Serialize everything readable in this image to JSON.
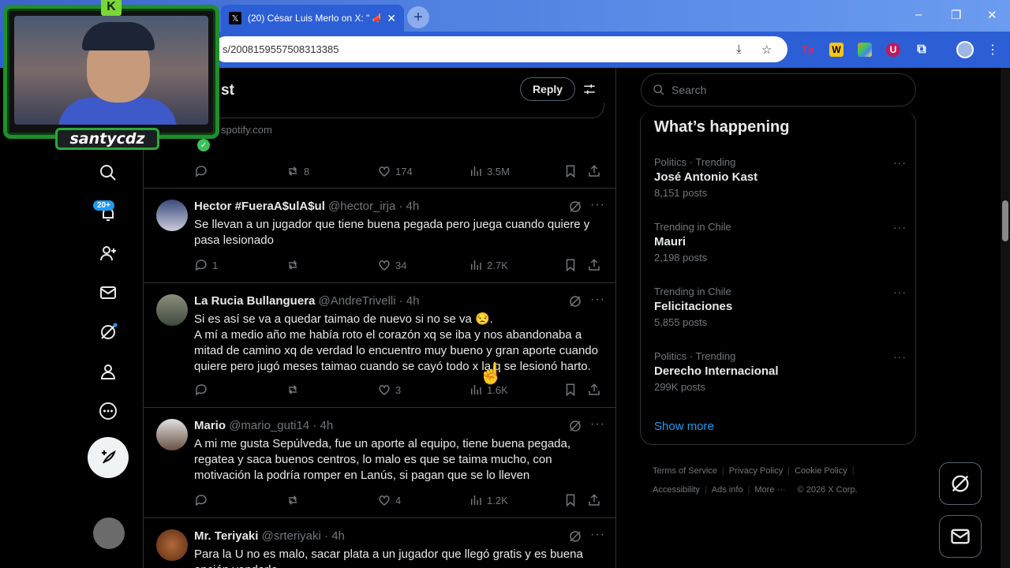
{
  "browser": {
    "tab_title": "(20) César Luis Merlo on X: \" 📣",
    "url": "s/2008159557508313385",
    "extensions": [
      "Tp",
      "W",
      "U"
    ],
    "win_min": "–",
    "win_max": "❐",
    "win_close": "✕"
  },
  "webcam": {
    "channel_name": "santycdz"
  },
  "nav": {
    "notifications_badge": "20+"
  },
  "reply_bar": {
    "partial_title": "st",
    "reply_label": "Reply"
  },
  "prev_tweet": {
    "link_domain": "spotify.com",
    "retweets": "8",
    "likes": "174",
    "views": "3.5M"
  },
  "tweets": [
    {
      "name": "Hector #FueraA$ulA$ul",
      "handle": "@hector_irja",
      "time": "4h",
      "text": "Se llevan a un jugador que tiene buena pegada pero juega cuando quiere y pasa lesionado",
      "replies": "1",
      "retweets": "",
      "likes": "34",
      "views": "2.7K"
    },
    {
      "name": "La Rucia Bullanguera",
      "handle": "@AndreTrivelli",
      "time": "4h",
      "text": "Si es así se va a quedar taimao de nuevo si no se va 😒.\nA mí a medio año me había roto el corazón xq se iba y nos abandonaba a mitad de camino xq de verdad lo encuentro muy bueno y gran aporte cuando quiere pero jugó meses taimao cuando se cayó todo x la q se lesionó harto.",
      "replies": "",
      "retweets": "",
      "likes": "3",
      "views": "1.6K"
    },
    {
      "name": "Mario",
      "handle": "@mario_guti14",
      "time": "4h",
      "text": "A mi me gusta Sepúlveda, fue un aporte al equipo, tiene buena pegada, regatea y saca buenos centros, lo malo es que se taima mucho, con motivación la podría romper en Lanús, si pagan que se lo lleven",
      "replies": "",
      "retweets": "",
      "likes": "4",
      "views": "1.2K"
    },
    {
      "name": "Mr. Teriyaki",
      "handle": "@srteriyaki",
      "time": "4h",
      "text": "Para la U no es malo, sacar plata a un jugador que llegó gratis y es buena opción venderlo.",
      "replies": "",
      "retweets": "",
      "likes": "",
      "views": ""
    }
  ],
  "sidebar": {
    "search_placeholder": "Search",
    "whats_happening": "What’s happening",
    "trends": [
      {
        "context": "Politics · Trending",
        "topic": "José Antonio Kast",
        "count": "8,151 posts"
      },
      {
        "context": "Trending in Chile",
        "topic": "Mauri",
        "count": "2,198 posts"
      },
      {
        "context": "Trending in Chile",
        "topic": "Felicitaciones",
        "count": "5,855 posts"
      },
      {
        "context": "Politics · Trending",
        "topic": "Derecho Internacional",
        "count": "299K posts"
      }
    ],
    "show_more": "Show more",
    "footer": {
      "terms": "Terms of Service",
      "privacy": "Privacy Policy",
      "cookie": "Cookie Policy",
      "accessibility": "Accessibility",
      "ads": "Ads info",
      "more": "More ···",
      "copyright": "© 2026 X Corp."
    }
  },
  "colors": {
    "accent": "#1d9bf0",
    "background": "#000000",
    "border": "#2f3336",
    "muted": "#71767b"
  }
}
